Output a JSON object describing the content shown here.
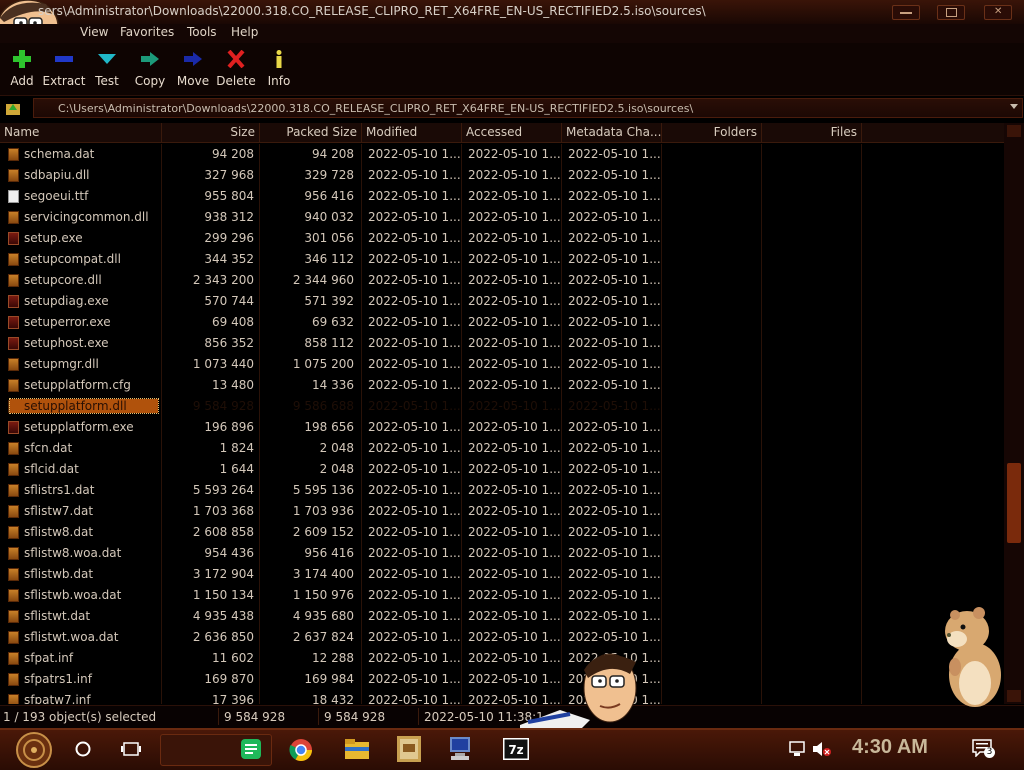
{
  "window": {
    "title": "sers\\Administrator\\Downloads\\22000.318.CO_RELEASE_CLIPRO_RET_X64FRE_EN-US_RECTIFIED2.5.iso\\sources\\"
  },
  "menu": [
    "View",
    "Favorites",
    "Tools",
    "Help"
  ],
  "toolbar": {
    "add": "Add",
    "extract": "Extract",
    "test": "Test",
    "copy": "Copy",
    "move": "Move",
    "delete": "Delete",
    "info": "Info"
  },
  "address": {
    "path": "C:\\Users\\Administrator\\Downloads\\22000.318.CO_RELEASE_CLIPRO_RET_X64FRE_EN-US_RECTIFIED2.5.iso\\sources\\"
  },
  "columns": {
    "name": "Name",
    "size": "Size",
    "packed": "Packed Size",
    "modified": "Modified",
    "accessed": "Accessed",
    "metadata": "Metadata Cha...",
    "folders": "Folders",
    "files": "Files"
  },
  "files": [
    {
      "name": "schema.dat",
      "size": "94 208",
      "packed": "94 208",
      "modified": "2022-05-10 1...",
      "accessed": "2022-05-10 1...",
      "metadata": "2022-05-10 1...",
      "icon": "file-icon"
    },
    {
      "name": "sdbapiu.dll",
      "size": "327 968",
      "packed": "329 728",
      "modified": "2022-05-10 1...",
      "accessed": "2022-05-10 1...",
      "metadata": "2022-05-10 1...",
      "icon": "file-icon"
    },
    {
      "name": "segoeui.ttf",
      "size": "955 804",
      "packed": "956 416",
      "modified": "2022-05-10 1...",
      "accessed": "2022-05-10 1...",
      "metadata": "2022-05-10 1...",
      "icon": "font-file-icon"
    },
    {
      "name": "servicingcommon.dll",
      "size": "938 312",
      "packed": "940 032",
      "modified": "2022-05-10 1...",
      "accessed": "2022-05-10 1...",
      "metadata": "2022-05-10 1...",
      "icon": "file-icon"
    },
    {
      "name": "setup.exe",
      "size": "299 296",
      "packed": "301 056",
      "modified": "2022-05-10 1...",
      "accessed": "2022-05-10 1...",
      "metadata": "2022-05-10 1...",
      "icon": "exe-icon"
    },
    {
      "name": "setupcompat.dll",
      "size": "344 352",
      "packed": "346 112",
      "modified": "2022-05-10 1...",
      "accessed": "2022-05-10 1...",
      "metadata": "2022-05-10 1...",
      "icon": "file-icon"
    },
    {
      "name": "setupcore.dll",
      "size": "2 343 200",
      "packed": "2 344 960",
      "modified": "2022-05-10 1...",
      "accessed": "2022-05-10 1...",
      "metadata": "2022-05-10 1...",
      "icon": "file-icon"
    },
    {
      "name": "setupdiag.exe",
      "size": "570 744",
      "packed": "571 392",
      "modified": "2022-05-10 1...",
      "accessed": "2022-05-10 1...",
      "metadata": "2022-05-10 1...",
      "icon": "exe-icon"
    },
    {
      "name": "setuperror.exe",
      "size": "69 408",
      "packed": "69 632",
      "modified": "2022-05-10 1...",
      "accessed": "2022-05-10 1...",
      "metadata": "2022-05-10 1...",
      "icon": "exe-icon"
    },
    {
      "name": "setuphost.exe",
      "size": "856 352",
      "packed": "858 112",
      "modified": "2022-05-10 1...",
      "accessed": "2022-05-10 1...",
      "metadata": "2022-05-10 1...",
      "icon": "exe-icon"
    },
    {
      "name": "setupmgr.dll",
      "size": "1 073 440",
      "packed": "1 075 200",
      "modified": "2022-05-10 1...",
      "accessed": "2022-05-10 1...",
      "metadata": "2022-05-10 1...",
      "icon": "file-icon"
    },
    {
      "name": "setupplatform.cfg",
      "size": "13 480",
      "packed": "14 336",
      "modified": "2022-05-10 1...",
      "accessed": "2022-05-10 1...",
      "metadata": "2022-05-10 1...",
      "icon": "file-icon"
    },
    {
      "name": "setupplatform.dll",
      "size": "9 584 928",
      "packed": "9 586 688",
      "modified": "2022-05-10 1...",
      "accessed": "2022-05-10 1...",
      "metadata": "2022-05-10 1...",
      "icon": "file-icon"
    },
    {
      "name": "setupplatform.exe",
      "size": "196 896",
      "packed": "198 656",
      "modified": "2022-05-10 1...",
      "accessed": "2022-05-10 1...",
      "metadata": "2022-05-10 1...",
      "icon": "exe-icon"
    },
    {
      "name": "sfcn.dat",
      "size": "1 824",
      "packed": "2 048",
      "modified": "2022-05-10 1...",
      "accessed": "2022-05-10 1...",
      "metadata": "2022-05-10 1...",
      "icon": "file-icon"
    },
    {
      "name": "sflcid.dat",
      "size": "1 644",
      "packed": "2 048",
      "modified": "2022-05-10 1...",
      "accessed": "2022-05-10 1...",
      "metadata": "2022-05-10 1...",
      "icon": "file-icon"
    },
    {
      "name": "sflistrs1.dat",
      "size": "5 593 264",
      "packed": "5 595 136",
      "modified": "2022-05-10 1...",
      "accessed": "2022-05-10 1...",
      "metadata": "2022-05-10 1...",
      "icon": "file-icon"
    },
    {
      "name": "sflistw7.dat",
      "size": "1 703 368",
      "packed": "1 703 936",
      "modified": "2022-05-10 1...",
      "accessed": "2022-05-10 1...",
      "metadata": "2022-05-10 1...",
      "icon": "file-icon"
    },
    {
      "name": "sflistw8.dat",
      "size": "2 608 858",
      "packed": "2 609 152",
      "modified": "2022-05-10 1...",
      "accessed": "2022-05-10 1...",
      "metadata": "2022-05-10 1...",
      "icon": "file-icon"
    },
    {
      "name": "sflistw8.woa.dat",
      "size": "954 436",
      "packed": "956 416",
      "modified": "2022-05-10 1...",
      "accessed": "2022-05-10 1...",
      "metadata": "2022-05-10 1...",
      "icon": "file-icon"
    },
    {
      "name": "sflistwb.dat",
      "size": "3 172 904",
      "packed": "3 174 400",
      "modified": "2022-05-10 1...",
      "accessed": "2022-05-10 1...",
      "metadata": "2022-05-10 1...",
      "icon": "file-icon"
    },
    {
      "name": "sflistwb.woa.dat",
      "size": "1 150 134",
      "packed": "1 150 976",
      "modified": "2022-05-10 1...",
      "accessed": "2022-05-10 1...",
      "metadata": "2022-05-10 1...",
      "icon": "file-icon"
    },
    {
      "name": "sflistwt.dat",
      "size": "4 935 438",
      "packed": "4 935 680",
      "modified": "2022-05-10 1...",
      "accessed": "2022-05-10 1...",
      "metadata": "2022-05-10 1...",
      "icon": "file-icon"
    },
    {
      "name": "sflistwt.woa.dat",
      "size": "2 636 850",
      "packed": "2 637 824",
      "modified": "2022-05-10 1...",
      "accessed": "2022-05-10 1...",
      "metadata": "2022-05-10 1...",
      "icon": "file-icon"
    },
    {
      "name": "sfpat.inf",
      "size": "11 602",
      "packed": "12 288",
      "modified": "2022-05-10 1...",
      "accessed": "2022-05-10 1...",
      "metadata": "2022-05-10 1...",
      "icon": "file-icon"
    },
    {
      "name": "sfpatrs1.inf",
      "size": "169 870",
      "packed": "169 984",
      "modified": "2022-05-10 1...",
      "accessed": "2022-05-10 1...",
      "metadata": "2022-05-10 1...",
      "icon": "file-icon"
    },
    {
      "name": "sfpatw7.inf",
      "size": "17 396",
      "packed": "18 432",
      "modified": "2022-05-10 1...",
      "accessed": "2022-05-10 1...",
      "metadata": "2022-05-10 1...",
      "icon": "file-icon"
    }
  ],
  "selected_index": 12,
  "status": {
    "selection": "1 / 193 object(s) selected",
    "size": "9 584 928",
    "packed": "9 584 928",
    "modified": "2022-05-10 11:38:1"
  },
  "taskbar": {
    "clock": "4:30 AM",
    "notifications": "3"
  },
  "colors": {
    "accent": "#b0520c",
    "background": "#000000",
    "titlebar": "#3a1408"
  }
}
